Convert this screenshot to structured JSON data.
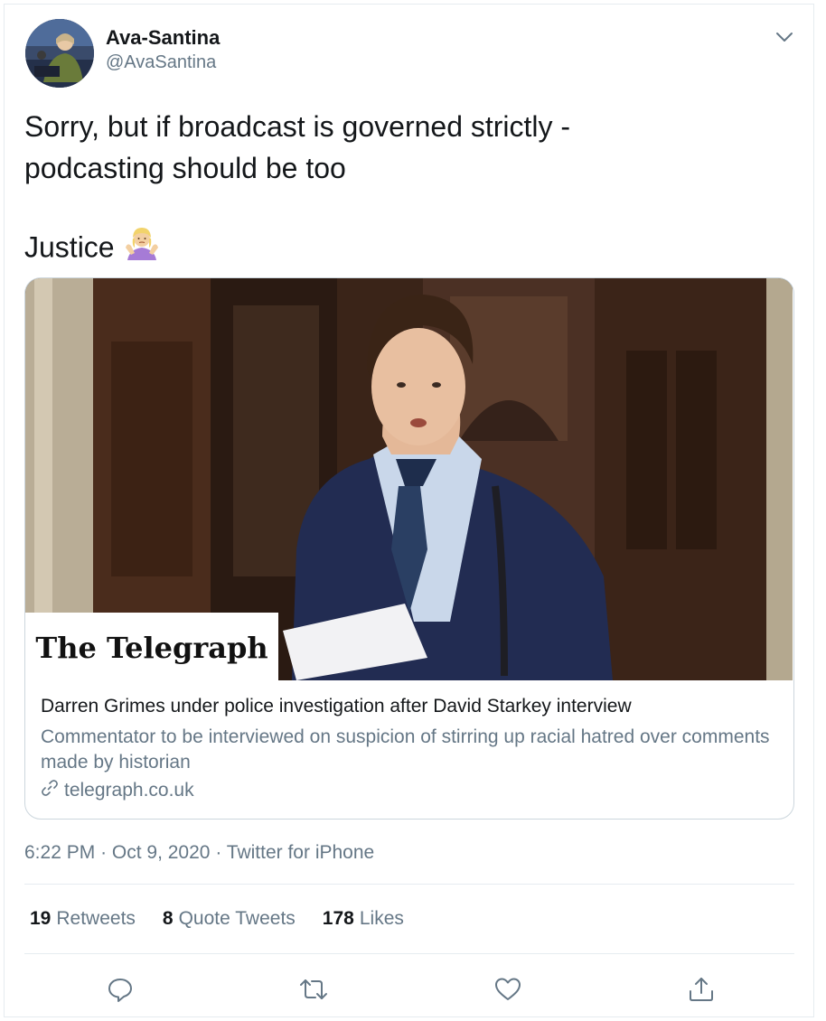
{
  "author": {
    "name": "Ava-Santina",
    "handle": "@AvaSantina"
  },
  "tweet": {
    "text_line1": "Sorry, but if broadcast is governed strictly -",
    "text_line2": "podcasting should be too",
    "text_line3": "Justice",
    "emoji_icon": "woman-shrugging-emoji"
  },
  "card": {
    "image_logo_text": "The Telegraph",
    "title": "Darren Grimes under police investigation after David Starkey interview",
    "description": "Commentator to be interviewed on suspicion of stirring up racial hatred over comments made by historian",
    "domain": "telegraph.co.uk"
  },
  "meta": {
    "time": "6:22 PM",
    "date": "Oct 9, 2020",
    "source": "Twitter for iPhone",
    "separator": "·"
  },
  "stats": {
    "retweets_count": "19",
    "retweets_label": "Retweets",
    "quotes_count": "8",
    "quotes_label": "Quote Tweets",
    "likes_count": "178",
    "likes_label": "Likes"
  },
  "colors": {
    "text": "#14171a",
    "secondary": "#657786",
    "border": "#e6ecf0"
  }
}
